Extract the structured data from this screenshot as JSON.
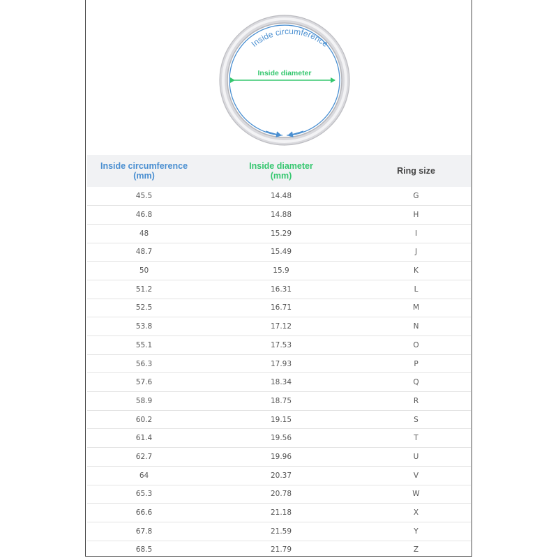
{
  "diagram": {
    "circumference_label": "Inside circumference",
    "diameter_label": "Inside diameter",
    "colors": {
      "circumference": "#4a8fd1",
      "diameter": "#35c76f",
      "ring_outer": "#c8c8cc",
      "ring_inner": "#e6e6ea"
    }
  },
  "chart_data": {
    "type": "table",
    "columns": [
      {
        "key": "circumference",
        "label_line1": "Inside circumference",
        "label_line2": "(mm)"
      },
      {
        "key": "diameter",
        "label_line1": "Inside diameter",
        "label_line2": "(mm)"
      },
      {
        "key": "size",
        "label_line1": "Ring size",
        "label_line2": ""
      }
    ],
    "rows": [
      [
        "45.5",
        "14.48",
        "G"
      ],
      [
        "46.8",
        "14.88",
        "H"
      ],
      [
        "48",
        "15.29",
        "I"
      ],
      [
        "48.7",
        "15.49",
        "J"
      ],
      [
        "50",
        "15.9",
        "K"
      ],
      [
        "51.2",
        "16.31",
        "L"
      ],
      [
        "52.5",
        "16.71",
        "M"
      ],
      [
        "53.8",
        "17.12",
        "N"
      ],
      [
        "55.1",
        "17.53",
        "O"
      ],
      [
        "56.3",
        "17.93",
        "P"
      ],
      [
        "57.6",
        "18.34",
        "Q"
      ],
      [
        "58.9",
        "18.75",
        "R"
      ],
      [
        "60.2",
        "19.15",
        "S"
      ],
      [
        "61.4",
        "19.56",
        "T"
      ],
      [
        "62.7",
        "19.96",
        "U"
      ],
      [
        "64",
        "20.37",
        "V"
      ],
      [
        "65.3",
        "20.78",
        "W"
      ],
      [
        "66.6",
        "21.18",
        "X"
      ],
      [
        "67.8",
        "21.59",
        "Y"
      ],
      [
        "68.5",
        "21.79",
        "Z"
      ]
    ]
  }
}
